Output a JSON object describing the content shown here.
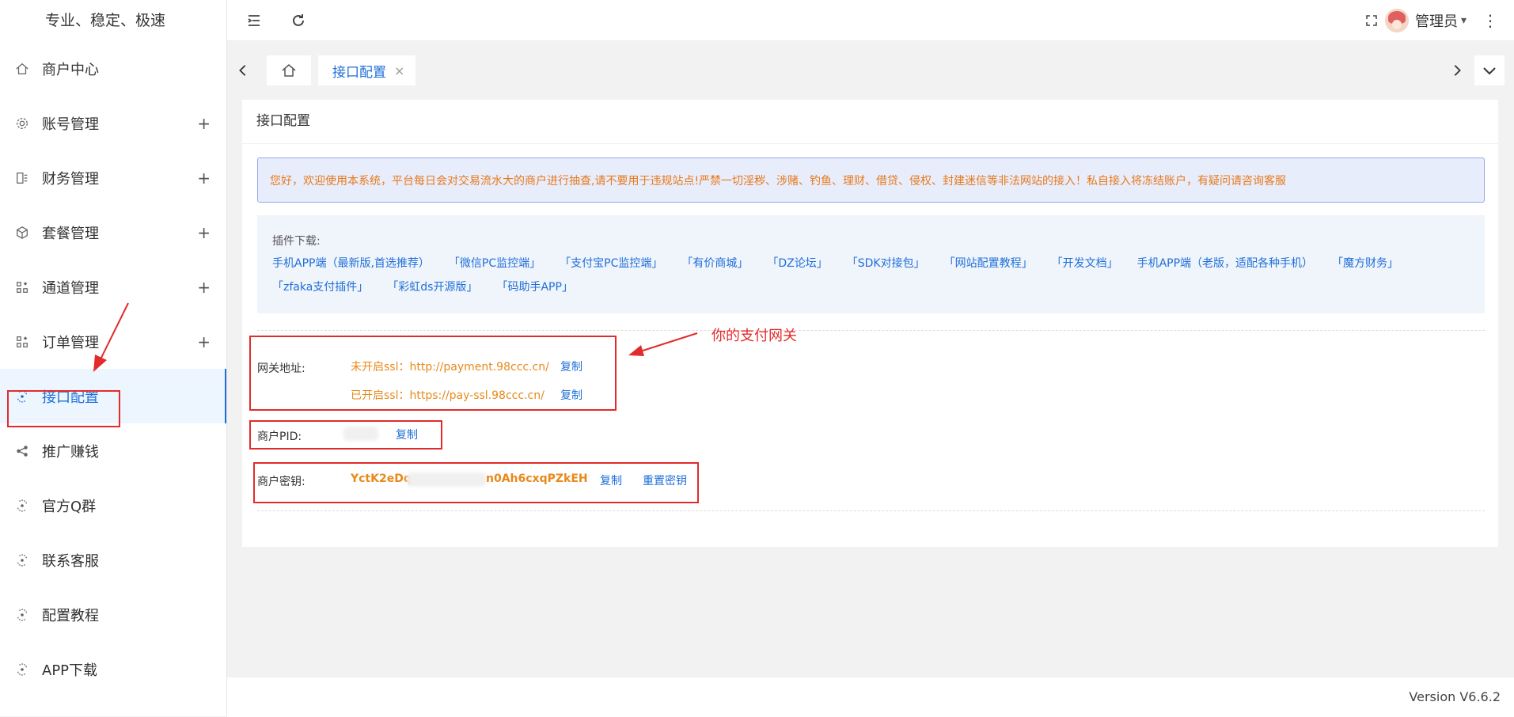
{
  "brand": "专业、稳定、极速",
  "sidebar": {
    "items": [
      {
        "label": "商户中心",
        "icon": "home-icon",
        "expandable": false,
        "active": false
      },
      {
        "label": "账号管理",
        "icon": "gear-icon",
        "expandable": true,
        "active": false
      },
      {
        "label": "财务管理",
        "icon": "finance-icon",
        "expandable": true,
        "active": false
      },
      {
        "label": "套餐管理",
        "icon": "cube-icon",
        "expandable": true,
        "active": false
      },
      {
        "label": "通道管理",
        "icon": "apps-icon",
        "expandable": true,
        "active": false
      },
      {
        "label": "订单管理",
        "icon": "apps-icon",
        "expandable": true,
        "active": false
      },
      {
        "label": "接口配置",
        "icon": "api-icon",
        "expandable": false,
        "active": true
      },
      {
        "label": "推广赚钱",
        "icon": "share-icon",
        "expandable": false,
        "active": false
      },
      {
        "label": "官方Q群",
        "icon": "api-icon",
        "expandable": false,
        "active": false
      },
      {
        "label": "联系客服",
        "icon": "api-icon",
        "expandable": false,
        "active": false
      },
      {
        "label": "配置教程",
        "icon": "api-icon",
        "expandable": false,
        "active": false
      },
      {
        "label": "APP下载",
        "icon": "api-icon",
        "expandable": false,
        "active": false
      }
    ],
    "plus": "+"
  },
  "header": {
    "user_name": "管理员",
    "caret": "▾",
    "more": "⋮"
  },
  "tabs": {
    "active_label": "接口配置",
    "close": "×"
  },
  "card": {
    "title": "接口配置",
    "notice": "您好，欢迎使用本系统，平台每日会对交易流水大的商户进行抽查,请不要用于违规站点!严禁一切淫秽、涉赌、钓鱼、理财、借贷、侵权、封建迷信等非法网站的接入！私自接入将冻结账户，有疑问请咨询客服",
    "plugins_label": "插件下载:",
    "plugins": [
      "手机APP端（最新版,首选推荐）",
      "「微信PC监控端」",
      "「支付宝PC监控端」",
      "「有价商城」",
      "「DZ论坛」",
      "「SDK对接包」",
      "「网站配置教程」",
      "「开发文档」",
      "手机APP端（老版，适配各种手机）",
      "「魔方财务」",
      "「zfaka支付插件」",
      "「彩虹ds开源版」",
      "「码助手APP」"
    ],
    "gateway_label": "网关地址:",
    "gateway_http": "未开启ssl：http://payment.98ccc.cn/",
    "gateway_https": "已开启ssl：https://pay-ssl.98ccc.cn/",
    "copy": "复制",
    "pid_label": "商户PID:",
    "key_label": "商户密钥:",
    "key_prefix": "YctK2eDq",
    "key_suffix": "n0Ah6cxqPZkEH",
    "reset_key": "重置密钥",
    "annotation": "你的支付网关"
  },
  "footer": {
    "version": "Version V6.6.2"
  },
  "colors": {
    "accent": "#1e6fd9",
    "warning_text": "#e8791a",
    "annotation_red": "#e32b2b"
  }
}
